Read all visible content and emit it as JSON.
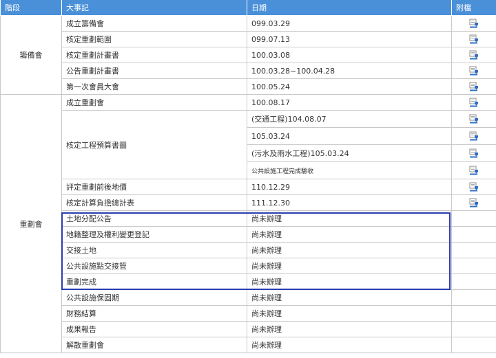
{
  "headers": {
    "stage": "階段",
    "event": "大事記",
    "date": "日期",
    "attachment": "附檔"
  },
  "stages": {
    "s1": "籌備會",
    "s2": "重劃會"
  },
  "rows": [
    {
      "event": "成立籌備會",
      "date": "099.03.29",
      "icon": "download-icon"
    },
    {
      "event": "核定重劃範圍",
      "date": "099.07.13",
      "icon": "download-icon"
    },
    {
      "event": "核定重劃計畫書",
      "date": "100.03.08",
      "icon": "download-icon"
    },
    {
      "event": "公告重劃計畫書",
      "date": "100.03.28~100.04.28",
      "icon": "download-icon"
    },
    {
      "event": "第一次會員大會",
      "date": "100.05.24",
      "icon": "download-icon"
    },
    {
      "event": "成立重劃會",
      "date": "100.08.17",
      "icon": "download-icon"
    },
    {
      "event": "核定工程預算書圖",
      "date": "(交通工程)104.08.07",
      "icon": "download-icon"
    },
    {
      "date": "105.03.24",
      "icon": "download-icon"
    },
    {
      "date": "(污水及雨水工程)105.03.24",
      "icon": "download-icon"
    },
    {
      "date": "公共設施工程完成驗收",
      "icon": "download-icon"
    },
    {
      "event": "評定重劃前後地價",
      "date": "110.12.29",
      "icon": "download-icon"
    },
    {
      "event": "核定計算負擔總計表",
      "date": "111.12.30",
      "icon": "download-icon"
    },
    {
      "event": "土地分配公告",
      "date": "尚未辦理"
    },
    {
      "event": "地籍整理及權利變更登記",
      "date": "尚未辦理"
    },
    {
      "event": "交接土地",
      "date": "尚未辦理"
    },
    {
      "event": "公共設施點交接管",
      "date": "尚未辦理"
    },
    {
      "event": "重劃完成",
      "date": "尚未辦理"
    },
    {
      "event": "公共設施保固期",
      "date": "尚未辦理"
    },
    {
      "event": "財務結算",
      "date": "尚未辦理"
    },
    {
      "event": "成果報告",
      "date": "尚未辦理"
    },
    {
      "event": "解散重劃會",
      "date": "尚未辦理"
    }
  ],
  "colors": {
    "header_bg": "#4a90d9",
    "highlight_border": "#2a3cb0",
    "icon_blue": "#2f6fc6"
  }
}
